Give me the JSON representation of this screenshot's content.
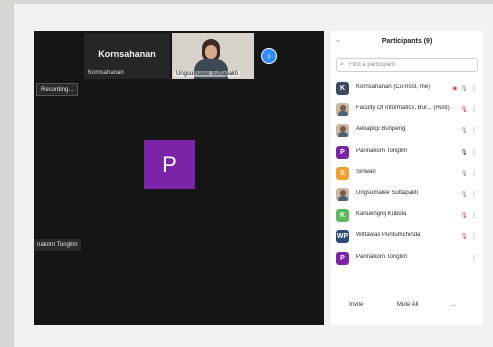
{
  "gallery": {
    "tile1": {
      "big_name": "Kornsahanan",
      "small_name": "Kornsahanan"
    },
    "tile2": {
      "small_name": "Ungsumalee Suttapakti"
    },
    "next_arrow": "›",
    "recording_label": "Recording...",
    "active_speaker_initial": "P",
    "active_speaker_name": "nakorn Tonglim"
  },
  "participants": {
    "collapse_icon": "⌄",
    "title": "Participants (9)",
    "search_placeholder": "Find a participant",
    "list": [
      {
        "initials": "K",
        "avatar_color": "#3b4a5e",
        "name": "Kornsahanan (Co-host, me)",
        "icons": [
          "record",
          "mic",
          "more"
        ]
      },
      {
        "initials": "",
        "avatar_color": "photo",
        "name": "Faculty Of Informatics, Bur... (Host)",
        "icons": [
          "mic-muted",
          "more"
        ]
      },
      {
        "initials": "",
        "avatar_color": "photo",
        "name": "Aekapop Bunpeng",
        "icons": [
          "mic",
          "more"
        ]
      },
      {
        "initials": "P",
        "avatar_color": "#7b24a8",
        "name": "Pannakorn Tonglim",
        "icons": [
          "mic-active",
          "more"
        ]
      },
      {
        "initials": "S",
        "avatar_color": "#f0a030",
        "name": "Siriwan",
        "icons": [
          "mic",
          "more"
        ]
      },
      {
        "initials": "",
        "avatar_color": "photo",
        "name": "Ungsumalee Suttapakti",
        "icons": [
          "mic",
          "more"
        ]
      },
      {
        "initials": "K",
        "avatar_color": "#5cb85c",
        "name": "Kanuengnij Kubola",
        "icons": [
          "mic-muted",
          "more"
        ]
      },
      {
        "initials": "WP",
        "avatar_color": "#2c4a7a",
        "name": "Wittawas Puntumchinda",
        "icons": [
          "mic-muted",
          "more"
        ]
      },
      {
        "initials": "P",
        "avatar_color": "#7b24a8",
        "name": "Pannakorn Tonglim",
        "icons": [
          "more"
        ]
      }
    ],
    "footer": {
      "invite": "Invite",
      "mute_all": "Mute All",
      "more": "..."
    }
  }
}
